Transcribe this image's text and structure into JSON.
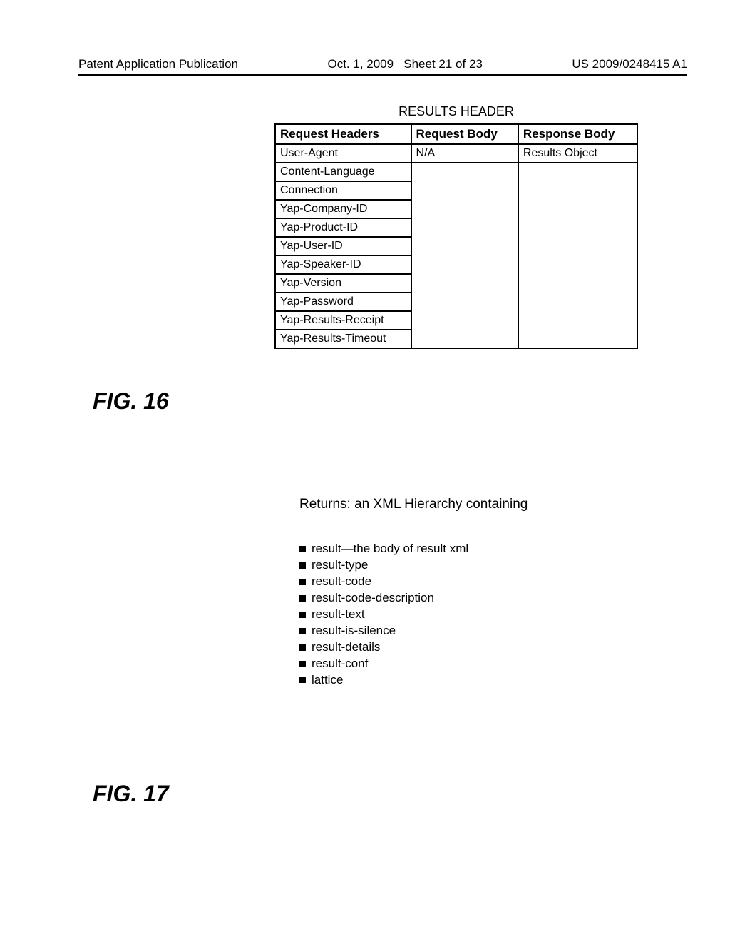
{
  "header": {
    "left": "Patent Application Publication",
    "date": "Oct. 1, 2009",
    "sheet": "Sheet 21 of 23",
    "pubno": "US 2009/0248415 A1"
  },
  "fig16": {
    "title": "RESULTS HEADER",
    "columns": [
      "Request Headers",
      "Request Body",
      "Response Body"
    ],
    "request_headers": [
      "User-Agent",
      "Content-Language",
      "Connection",
      "Yap-Company-ID",
      "Yap-Product-ID",
      "Yap-User-ID",
      "Yap-Speaker-ID",
      "Yap-Version",
      "Yap-Password",
      "Yap-Results-Receipt",
      "Yap-Results-Timeout"
    ],
    "request_body_first": "N/A",
    "response_body_first": "Results Object",
    "label": "FIG. 16"
  },
  "fig17": {
    "title": "Returns: an XML Hierarchy containing",
    "items": [
      "result—the body of result xml",
      "result-type",
      "result-code",
      "result-code-description",
      "result-text",
      "result-is-silence",
      "result-details",
      "result-conf",
      "lattice"
    ],
    "label": "FIG. 17"
  }
}
